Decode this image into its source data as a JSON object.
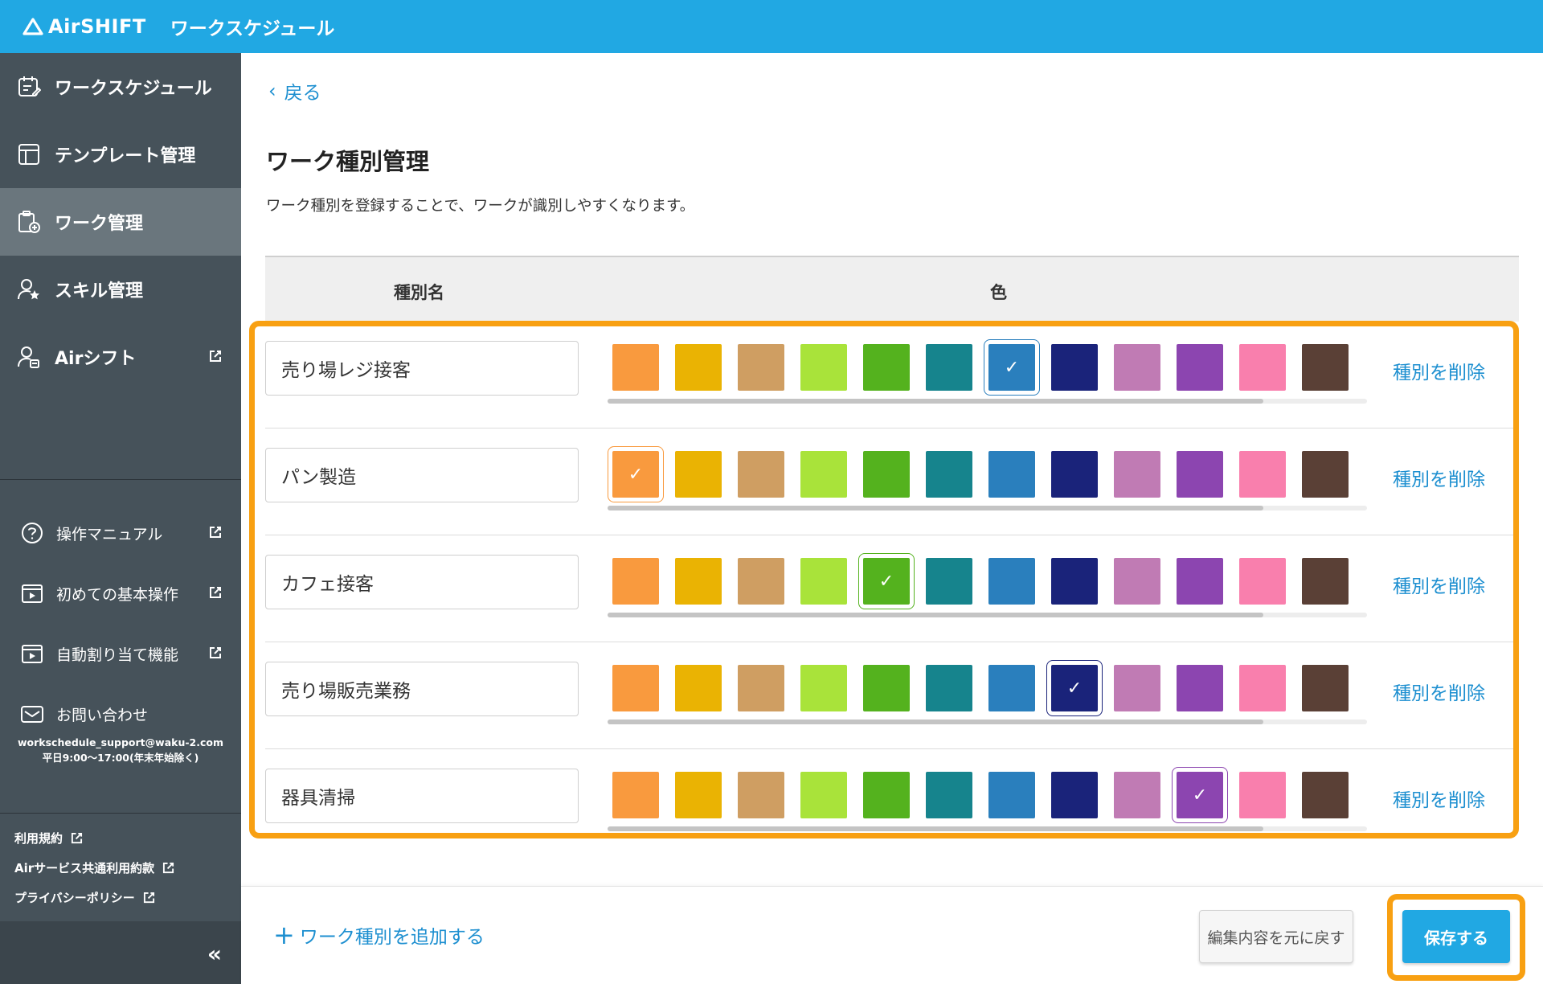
{
  "header": {
    "brand": "AirSHIFT",
    "app_title": "ワークスケジュール"
  },
  "sidebar": {
    "nav": [
      {
        "label": "ワークスケジュール",
        "icon": "calendar-edit-icon"
      },
      {
        "label": "テンプレート管理",
        "icon": "template-icon"
      },
      {
        "label": "ワーク管理",
        "icon": "clipboard-add-icon",
        "active": true
      },
      {
        "label": "スキル管理",
        "icon": "user-star-icon"
      },
      {
        "label": "Airシフト",
        "icon": "user-clock-icon",
        "external": true
      }
    ],
    "help": [
      {
        "label": "操作マニュアル",
        "icon": "question-circle-icon"
      },
      {
        "label": "初めての基本操作",
        "icon": "video-icon"
      },
      {
        "label": "自動割り当て機能",
        "icon": "video-icon"
      },
      {
        "label": "お問い合わせ",
        "icon": "mail-icon"
      }
    ],
    "support_email": "workschedule_support@waku-2.com",
    "support_hours": "平日9:00〜17:00(年末年始除く)",
    "legal": [
      "利用規約",
      "Airサービス共通利用約款",
      "プライバシーポリシー"
    ],
    "collapse_label": "«"
  },
  "main": {
    "back_label": "戻る",
    "title": "ワーク種別管理",
    "description": "ワーク種別を登録することで、ワークが識別しやすくなります。",
    "table": {
      "col_name": "種別名",
      "col_color": "色"
    },
    "delete_label": "種別を削除",
    "add_label": "ワーク種別を追加する",
    "revert_label": "編集内容を元に戻す",
    "save_label": "保存する"
  },
  "palette": [
    "#f99a3e",
    "#eab303",
    "#cf9e62",
    "#a9e33a",
    "#54b21e",
    "#16848d",
    "#2a7fbd",
    "#1a237a",
    "#c07bb4",
    "#8c45b0",
    "#f97fad",
    "#5a4036"
  ],
  "accent_color": "#21a8e3",
  "highlight_color": "#f8a012",
  "rows": [
    {
      "name": "売り場レジ接客",
      "selected": 6
    },
    {
      "name": "パン製造",
      "selected": 0
    },
    {
      "name": "カフェ接客",
      "selected": 4
    },
    {
      "name": "売り場販売業務",
      "selected": 7
    },
    {
      "name": "器具清掃",
      "selected": 9
    }
  ]
}
